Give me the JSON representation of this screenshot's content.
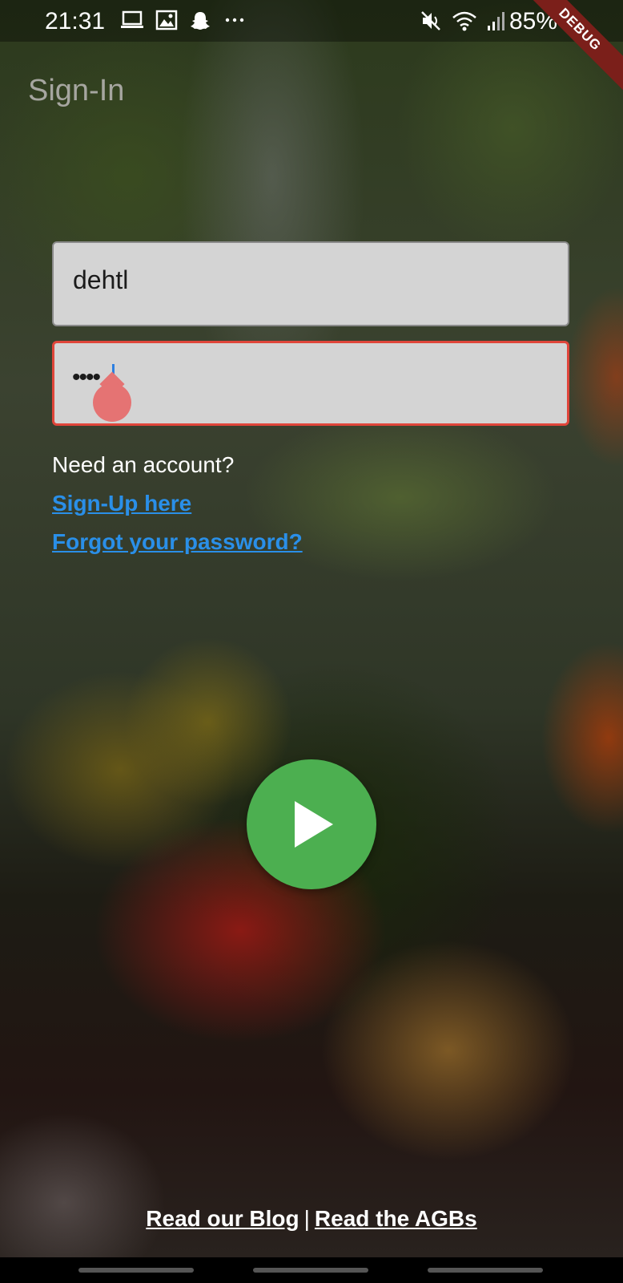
{
  "status_bar": {
    "time": "21:31",
    "battery": "85%",
    "left_icons": [
      "laptop-icon",
      "image-icon",
      "snapchat-icon",
      "more-icon"
    ],
    "right_icons": [
      "mute-icon",
      "wifi-icon",
      "signal-icon",
      "battery-icon"
    ]
  },
  "debug_banner": "DEBUG",
  "header": {
    "title": "Sign-In"
  },
  "form": {
    "username_value": "dehtl",
    "password_value": "••••",
    "password_error_color": "#e0453a"
  },
  "links": {
    "need_account": "Need an account?",
    "signup": "Sign-Up here",
    "forgot": "Forgot your password?"
  },
  "play_button": {
    "icon": "play-icon",
    "color": "#4caf50"
  },
  "footer": {
    "blog": "Read our Blog",
    "separator": "|",
    "agbs": "Read the AGBs"
  },
  "colors": {
    "link": "#2a8fe8",
    "field_bg": "#d4d4d4"
  }
}
